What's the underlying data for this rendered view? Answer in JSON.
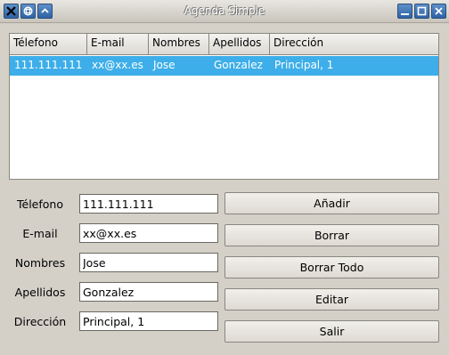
{
  "window": {
    "title": "Agenda Simple",
    "controls": [
      "close-icon",
      "maximize-restore-icon",
      "shade-icon",
      "minimize-icon",
      "maximize-icon",
      "close-window-icon"
    ]
  },
  "table": {
    "columns": [
      "Télefono",
      "E-mail",
      "Nombres",
      "Apellidos",
      "Dirección"
    ],
    "rows": [
      [
        "111.111.111",
        "xx@xx.es",
        "Jose",
        "Gonzalez",
        "Principal, 1"
      ]
    ],
    "selected_row": 0
  },
  "form": {
    "telefono": {
      "label": "Télefono",
      "value": "111.111.111"
    },
    "email": {
      "label": "E-mail",
      "value": "xx@xx.es"
    },
    "nombres": {
      "label": "Nombres",
      "value": "Jose"
    },
    "apellidos": {
      "label": "Apellidos",
      "value": "Gonzalez"
    },
    "direccion": {
      "label": "Dirección",
      "value": "Principal, 1"
    }
  },
  "buttons": {
    "anadir": "Añadir",
    "borrar": "Borrar",
    "borrar_todo": "Borrar Todo",
    "editar": "Editar",
    "salir": "Salir"
  },
  "colors": {
    "selection": "#3daee9",
    "window_bg": "#d4d0c8",
    "titlebar_button": "#2f62a5"
  }
}
